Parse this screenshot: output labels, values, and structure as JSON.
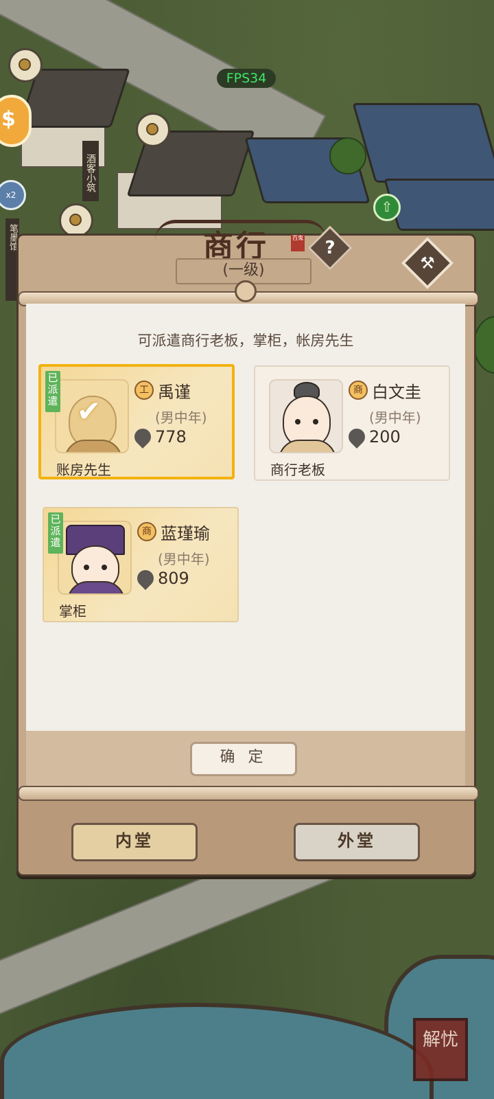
{
  "hud": {
    "fps_label": "FPS34"
  },
  "map": {
    "shop_sign": "酒客小筑",
    "left_sign": "笔墨馆",
    "badge_text": "x2",
    "corner_seal": "解忧"
  },
  "dialog": {
    "title": "商行",
    "title_stamp": "百鬼",
    "level": "(一级)",
    "help_icon": "?",
    "instruction": "可派遣商行老板，掌柜，帐房先生",
    "cards": [
      {
        "name": "禹谨",
        "type_badge": "工",
        "desc": "(男中年)",
        "stat": "778",
        "role": "账房先生",
        "assigned_label": "已派遣",
        "selected": true
      },
      {
        "name": "白文圭",
        "type_badge": "商",
        "desc": "(男中年)",
        "stat": "200",
        "role": "商行老板",
        "assigned_label": "",
        "selected": false
      },
      {
        "name": "蓝瑾瑜",
        "type_badge": "商",
        "desc": "(男中年)",
        "stat": "809",
        "role": "掌柜",
        "assigned_label": "已派遣",
        "selected": false
      }
    ],
    "confirm_label": "确 定",
    "tabs": [
      {
        "label": "内堂",
        "active": true
      },
      {
        "label": "外堂",
        "active": false
      }
    ]
  },
  "colors": {
    "selected_border": "#f2b211",
    "assigned_badge": "#5fb35a",
    "fps_text": "#3ee66a"
  }
}
